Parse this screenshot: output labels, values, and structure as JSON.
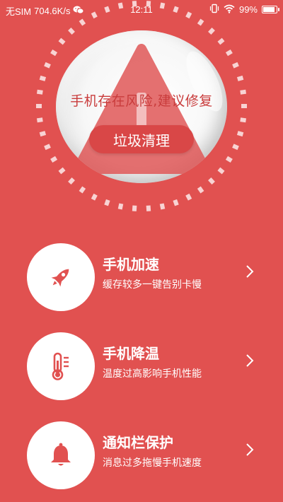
{
  "status_bar": {
    "carrier": "无SIM",
    "speed": "704.6K/s",
    "time": "12:11",
    "battery": "99%",
    "battery_level": 0.99,
    "icons": [
      "wechat-icon",
      "vibrate-icon",
      "wifi-icon",
      "battery-icon"
    ]
  },
  "hero": {
    "risk_message": "手机存在风险,建议修复",
    "clean_button_label": "垃圾清理",
    "warning_icon": "warning-triangle-icon"
  },
  "menu": [
    {
      "title": "手机加速",
      "subtitle": "缓存较多一键告别卡慢",
      "icon": "rocket-icon"
    },
    {
      "title": "手机降温",
      "subtitle": "温度过高影响手机性能",
      "icon": "thermometer-icon"
    },
    {
      "title": "通知栏保护",
      "subtitle": "消息过多拖慢手机速度",
      "icon": "bell-icon"
    }
  ],
  "colors": {
    "background": "#e15150",
    "accent_text": "#c93c3c",
    "button": "#d94747",
    "white": "#ffffff"
  }
}
